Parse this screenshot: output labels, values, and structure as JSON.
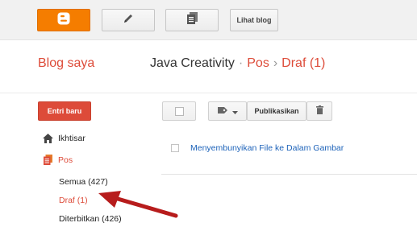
{
  "toolbar": {
    "view_blog_label": "Lihat blog",
    "icons": [
      "blogger-logo-icon",
      "pencil-icon",
      "posts-list-icon"
    ]
  },
  "header": {
    "blog_list_title": "Blog saya",
    "blog_name": "Java Creativity",
    "separator_dot": "·",
    "section": "Pos",
    "separator_arrow": "›",
    "subsection": "Draf (1)"
  },
  "sidebar": {
    "new_post_label": "Entri baru",
    "items": [
      {
        "label": "Ikhtisar",
        "icon": "home-icon"
      },
      {
        "label": "Pos",
        "icon": "posts-icon"
      }
    ],
    "sub_items": [
      {
        "label": "Semua (427)"
      },
      {
        "label": "Draf (1)"
      },
      {
        "label": "Diterbitkan (426)"
      }
    ]
  },
  "actions": {
    "publish_label": "Publikasikan",
    "icons": [
      "label-tag-icon",
      "trash-icon"
    ]
  },
  "posts": [
    {
      "title": "Menyembunyikan File ke Dalam Gambar"
    }
  ],
  "colors": {
    "accent_orange": "#f57d00",
    "accent_red": "#dd4b39",
    "link_blue": "#1c62b9",
    "annotation_arrow": "#b71c1c"
  }
}
